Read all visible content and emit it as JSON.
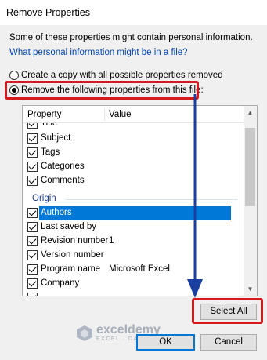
{
  "window": {
    "title": "Remove Properties"
  },
  "info_text": "Some of these properties might contain personal information.",
  "link_text": "What personal information might be in a file?",
  "options": {
    "copy_label": "Create a copy with all possible properties removed",
    "remove_label": "Remove the following properties from this file:",
    "selected": "remove"
  },
  "list": {
    "headers": {
      "property": "Property",
      "value": "Value"
    },
    "top_items": [
      {
        "name": "Title",
        "value": "",
        "checked": true
      },
      {
        "name": "Subject",
        "value": "",
        "checked": true
      },
      {
        "name": "Tags",
        "value": "",
        "checked": true
      },
      {
        "name": "Categories",
        "value": "",
        "checked": true
      },
      {
        "name": "Comments",
        "value": "",
        "checked": true
      }
    ],
    "group_label": "Origin",
    "origin_items": [
      {
        "name": "Authors",
        "value": "",
        "checked": true,
        "selected": true
      },
      {
        "name": "Last saved by",
        "value": "",
        "checked": true
      },
      {
        "name": "Revision number",
        "value": "1",
        "checked": true
      },
      {
        "name": "Version number",
        "value": "",
        "checked": true
      },
      {
        "name": "Program name",
        "value": "Microsoft Excel",
        "checked": true
      },
      {
        "name": "Company",
        "value": "",
        "checked": true
      }
    ]
  },
  "buttons": {
    "select_all": "Select All",
    "ok": "OK",
    "cancel": "Cancel"
  },
  "watermark": {
    "name": "exceldemy",
    "tagline": "EXCEL · DATA · BI"
  },
  "annotation_color": "#d71920",
  "arrow_color": "#1b3fa0"
}
